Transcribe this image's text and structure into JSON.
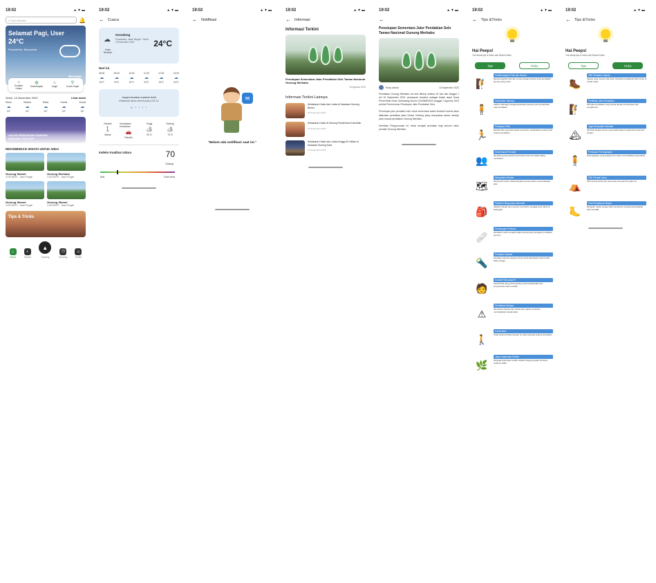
{
  "status": {
    "time": "19:02",
    "signal": "▲▼▬"
  },
  "home": {
    "search_placeholder": "Cari sesuatu",
    "greeting": "Selamat Pagi, User",
    "temp": "24°C",
    "location": "Purwokerto, Banyumas",
    "condition": "Berawan",
    "chips": [
      {
        "icon": "☼",
        "label": "Kualitas Udara"
      },
      {
        "icon": "◍",
        "label": "Kelembapan"
      },
      {
        "icon": "♨",
        "label": "Angin"
      },
      {
        "icon": "⚲",
        "label": "Curah Hujan"
      }
    ],
    "date": "Senin, 13 November 2023",
    "see_more": "Lihat detail",
    "week": [
      {
        "d": "Senin",
        "t": "24°"
      },
      {
        "d": "Selasa",
        "t": "24°"
      },
      {
        "d": "Rabu",
        "t": "24°"
      },
      {
        "d": "Kamis",
        "t": "24°"
      },
      {
        "d": "Jumat",
        "t": "24°"
      }
    ],
    "banner": "JALUR PENDAKIAN GUNUNG SINDORO DITUTUP",
    "reco_title": "REKOMENDASI WISATA UNTUK ANDA",
    "cards": [
      {
        "name": "Gunung Slamet",
        "region": "3.428 MDPL · Jawa Tengah"
      },
      {
        "name": "Gunung Merbabu",
        "region": "3.145 MDPL · Jawa Tengah"
      },
      {
        "name": "Gunung Slamet",
        "region": "3.428 MDPL · Jawa Tengah"
      },
      {
        "name": "Gunung Slamet",
        "region": "3.428 MDPL · Jawa Tengah"
      }
    ],
    "tips_banner": "Tips & Tricks",
    "nav": [
      {
        "icon": "⌂",
        "label": "Home"
      },
      {
        "icon": "◐",
        "label": "Search"
      },
      {
        "icon": "▲",
        "label": "Tracking"
      },
      {
        "icon": "❐",
        "label": "Booking"
      },
      {
        "icon": "☺",
        "label": "Profile"
      }
    ]
  },
  "cuaca": {
    "title": "Cuaca",
    "location": "Grendeng",
    "sub": "Purwokerto, Jawa Tengah · Senin, 13 November 2023",
    "cond": "Hujan Berawan",
    "temp": "24°C",
    "today": "Hari ini",
    "hours": [
      {
        "h": "08.00",
        "t": "24°C"
      },
      {
        "h": "09.00",
        "t": "24°C"
      },
      {
        "h": "10.00",
        "t": "24°C"
      },
      {
        "h": "11.00",
        "t": "24°C"
      },
      {
        "h": "12.00",
        "t": "24°C"
      },
      {
        "h": "13.00",
        "t": "24°C"
      }
    ],
    "uv_text": "Jangan lewatkan matahari terbit",
    "uv_sub": "Matahari akan terbit pukul 05.14",
    "stats": [
      {
        "icon": "🚶",
        "label": "Rendah",
        "v": "Bebas"
      },
      {
        "icon": "🚗",
        "label": "Kecelakaan Kendaraan",
        "v": "Rendah"
      },
      {
        "icon": "🏕",
        "label": "Tinggi",
        "v": "90 %"
      },
      {
        "icon": "🏕",
        "label": "Sedang",
        "v": "70 %"
      }
    ],
    "aqi_title": "Indeks Kualitas Udara",
    "aqi_value": "70",
    "aqi_level": "Cukup",
    "aqi_low": "Baik",
    "aqi_high": "Tidak sehat",
    "aqi_fraction": 0.22
  },
  "notif": {
    "title": "Notifikasi",
    "empty": "\"Belum ada notifikasi saat ini.\""
  },
  "info": {
    "title": "Informasi",
    "latest": "Informasi Terkini",
    "hero_title": "Penutupan Sementara Jalur Pendakian Selo Taman Nasional Gunung Merbabu",
    "hero_date": "16 Agustus 2023",
    "others": "Informasi Terkini Lainnya",
    "list": [
      {
        "t": "Kebakaran Hutan dan Lahan di Kawasan Gunung Bromo",
        "d": "06 September 2023"
      },
      {
        "t": "Kebakaran Hutan di Gunung Panderman Kota Batu",
        "d": "07 September 2023"
      },
      {
        "t": "Kebakaran Hutan dan Lahan hingga 40 Hektar di Kawasan Gunung Kawi",
        "d": "07 September 2023"
      }
    ]
  },
  "article": {
    "title": "Penutupan Sementara Jalur Pendakian Selo Taman Nasional Gunung Merbabu",
    "author": "Rizky Adinda",
    "date": "16 September 2023",
    "p1": "Pendakian Gunung Merbabu via selo ditutup selama 15 hari dan tanggal 1 s/d 15 September 2023. penutupan tersebut sebagai tindak lanjut Surat Pemerintah Desa Tarubatang Nomor 02/005/8/2023 tanggal 2 Agustus 2023 perihal Permohonan Penutupan Jalur Pendakian Selo.",
    "p2": "Penutupan jalur pendakin selo untuk sementara waktu tersebut karena akan dilakukan perbaikan jalan Dusun Genting yang merupakan akses menuju pintu masuk pendakian Gunung Merbabu.",
    "p3": "Demikian Pengumuman ini, untuk menjadi perhatian bagi seluruh calon pendaki Gunung Merbabu."
  },
  "tips": {
    "title": "Tips &Tricks",
    "hello": "Hai Peeps!",
    "hello_sub": "Yuk simak tips & tricks dari Bokoin hikes",
    "tab_tips": "Tips",
    "tab_tricks": "Tricks",
    "items": [
      {
        "icon": "🧗",
        "h": "Pertimbangkan Fisik dan Mental",
        "d": "Mempersiapkan fisik dan mental sangat penting untuk pendakian gunung yang aman."
      },
      {
        "icon": "🧍",
        "h": "Kesehatan Jantung",
        "d": "Latihan olahraga menjaga kesehatan jantung serta pernapasan saat pendakian."
      },
      {
        "icon": "🏃",
        "h": "Persiapan Fisik",
        "d": "Berlatih fisik yang baik dapat membantu menghadapi medan berat selama pendakian."
      },
      {
        "icon": "👥",
        "h": "Sekelompok Pendaki",
        "d": "Mendaki secara berkelompok lebih aman dan dapat saling membantu."
      },
      {
        "icon": "🗺",
        "h": "Mengetahui Medan",
        "d": "Mengenali medan adalah langkah penting dalam merencanakan jalur."
      },
      {
        "icon": "🎒",
        "h": "Pakaian Hiking yang Memadai",
        "d": "Pakaian hangat dan nyaman membantu menjaga suhu tubuh di ketinggian."
      },
      {
        "icon": "🩹",
        "h": "Pertolongan Pertama",
        "d": "Peralatan medis menjadi bagian penting dari persiapan pendakian gunung."
      },
      {
        "icon": "🔦",
        "h": "Peralatan Darurat",
        "d": "Peralatan darurat sangat penting untuk diantisipasi saat kondisi tidak terduga."
      },
      {
        "icon": "🧑",
        "h": "Kondisi Fisik yang Fit",
        "d": "Kondisi fisik yang prima penting untuk keselamatan dan kenyamanan saat mendaki."
      },
      {
        "icon": "⚠",
        "h": "Perhatikan Bahaya",
        "d": "Memahami bahaya dan tanda alam dapat membantu meningkatkan keselamatan."
      },
      {
        "icon": "🚶",
        "h": "Komunikasi",
        "d": "Tetap berkomunikasi dengan tim atau keluarga selama pendakian."
      },
      {
        "icon": "🌿",
        "h": "Jaga Lingkungan Sekitar",
        "d": "Menjaga lingkungan sekitar adalah tanggung jawab bersama setiap pendaki."
      }
    ],
    "tricks": [
      {
        "icon": "🥾",
        "h": "Pilih Peralatan Sepatu",
        "d": "Sepatu yang nyaman dan kuat membantu perjalanan lebih aman di medan terjal."
      },
      {
        "icon": "🧗",
        "h": "Pemilihan Jalur Pendakian",
        "d": "Pilih jalur pendakian yang sesuai dengan kemampuan dan pengalaman."
      },
      {
        "icon": "🏔",
        "h": "Jaga Kecepatan Mendaki",
        "d": "Mendaki dengan tempo yang stabil dapat menghemat energi dan tenaga."
      },
      {
        "icon": "🧍",
        "h": "Persiapan Perlengkapan",
        "d": "Perlengkapan yang lengkap dan ringan memudahkan pergerakan."
      },
      {
        "icon": "⛺",
        "h": "Pilih Tempat Camp",
        "d": "Pilih tempat berkemah yang aman dan jauh dari jalur air."
      },
      {
        "icon": "🦶",
        "h": "Pola Pengaturan Napas",
        "d": "Mengatur napas dengan baik membantu mengurangi kelelahan saat mendaki."
      }
    ]
  }
}
